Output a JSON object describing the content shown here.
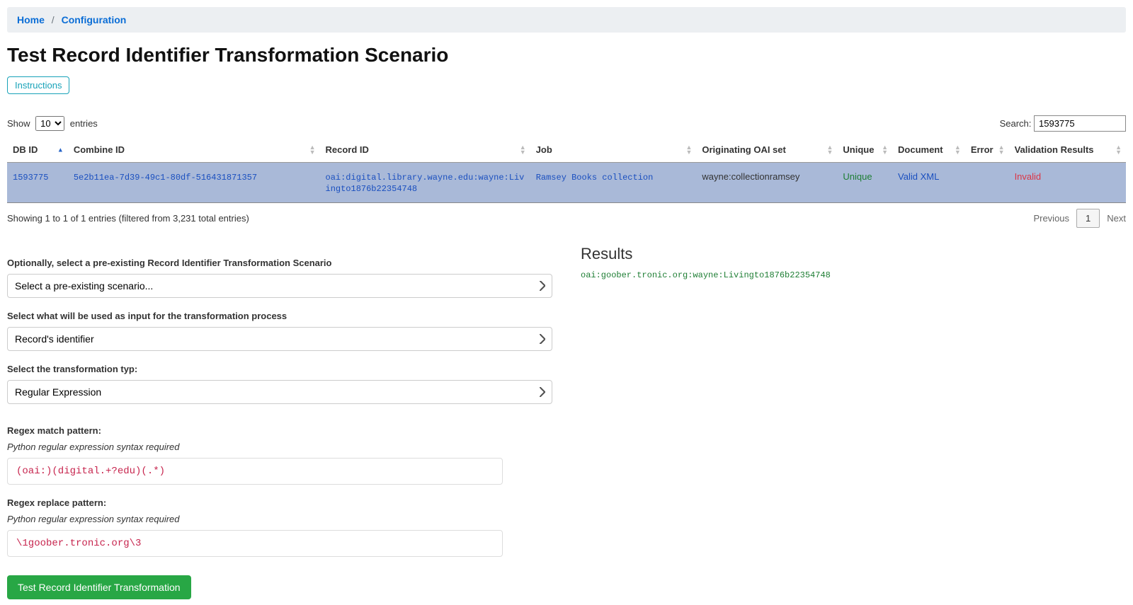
{
  "breadcrumb": {
    "home": "Home",
    "configuration": "Configuration",
    "sep": "/"
  },
  "page_title": "Test Record Identifier Transformation Scenario",
  "instructions_btn": "Instructions",
  "dt": {
    "show_prefix": "Show",
    "show_value": "10",
    "show_suffix": "entries",
    "search_label": "Search:",
    "search_value": "1593775",
    "columns": [
      "DB ID",
      "Combine ID",
      "Record ID",
      "Job",
      "Originating OAI set",
      "Unique",
      "Document",
      "Error",
      "Validation Results"
    ],
    "row": {
      "db_id": "1593775",
      "combine_id": "5e2b11ea-7d39-49c1-80df-516431871357",
      "record_id": "oai:digital.library.wayne.edu:wayne:Livingto1876b22354748",
      "job": "Ramsey Books collection",
      "oai_set": "wayne:collectionramsey",
      "unique": "Unique",
      "document": "Valid XML",
      "error": "",
      "validation": "Invalid"
    },
    "info": "Showing 1 to 1 of 1 entries (filtered from 3,231 total entries)",
    "prev": "Previous",
    "page": "1",
    "next": "Next"
  },
  "form": {
    "scenario_label": "Optionally, select a pre-existing Record Identifier Transformation Scenario",
    "scenario_value": "Select a pre-existing scenario...",
    "input_label": "Select what will be used as input for the transformation process",
    "input_value": "Record's identifier",
    "type_label": "Select the transformation typ:",
    "type_value": "Regular Expression",
    "match_label": "Regex match pattern:",
    "syntax_note": "Python regular expression syntax required",
    "match_value": "(oai:)(digital.+?edu)(.*)",
    "replace_label": "Regex replace pattern:",
    "replace_value": "\\1goober.tronic.org\\3",
    "submit": "Test Record Identifier Transformation"
  },
  "results": {
    "heading": "Results",
    "value": "oai:goober.tronic.org:wayne:Livingto1876b22354748"
  }
}
